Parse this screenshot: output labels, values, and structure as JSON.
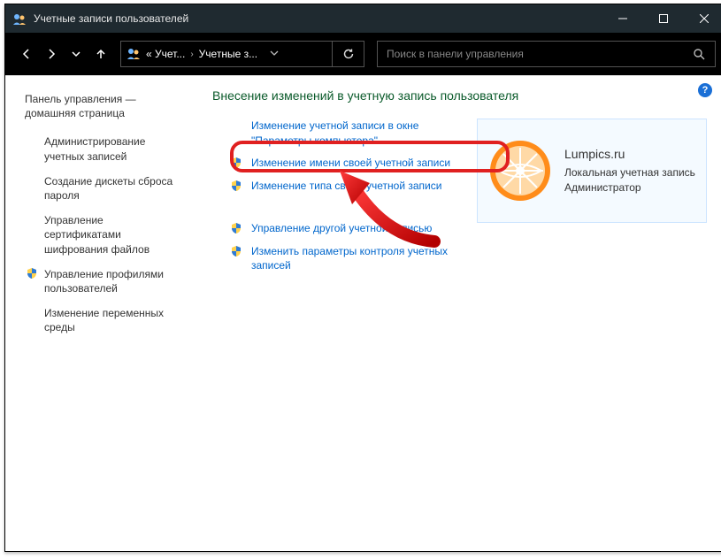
{
  "window": {
    "title": "Учетные записи пользователей"
  },
  "breadcrumb": {
    "seg1": "« Учет...",
    "seg2": "Учетные з..."
  },
  "search": {
    "placeholder": "Поиск в панели управления"
  },
  "sidebar": {
    "heading": "Панель управления — домашняя страница",
    "items": [
      {
        "label": "Администрирование учетных записей",
        "shield": false
      },
      {
        "label": "Создание дискеты сброса пароля",
        "shield": false
      },
      {
        "label": "Управление сертификатами шифрования файлов",
        "shield": false
      },
      {
        "label": "Управление профилями пользователей",
        "shield": true
      },
      {
        "label": "Изменение переменных среды",
        "shield": false
      }
    ]
  },
  "main": {
    "title": "Внесение изменений в учетную запись пользователя",
    "group1": [
      {
        "label": "Изменение учетной записи в окне \"Параметры компьютера\"",
        "shield": false
      },
      {
        "label": "Изменение имени своей учетной записи",
        "shield": true
      },
      {
        "label": "Изменение типа своей учетной записи",
        "shield": true
      }
    ],
    "group2": [
      {
        "label": "Управление другой учетной записью",
        "shield": true
      },
      {
        "label": "Изменить параметры контроля учетных записей",
        "shield": true
      }
    ]
  },
  "account": {
    "name": "Lumpics.ru",
    "type": "Локальная учетная запись",
    "role": "Администратор"
  }
}
